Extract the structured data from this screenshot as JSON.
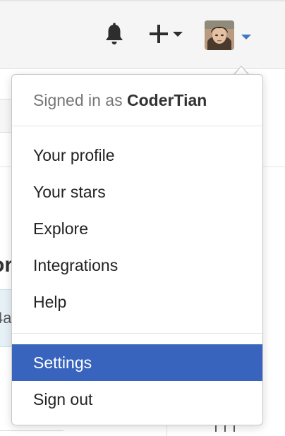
{
  "header": {
    "bell_icon": "bell-icon",
    "create_icon": "plus-icon",
    "create_caret_icon": "caret-down-icon",
    "avatar_icon": "user-avatar",
    "avatar_caret_icon": "caret-down-icon",
    "avatar_caret_color": "#4078c0"
  },
  "background": {
    "heading_fragment": "or",
    "box_fragment": "4a",
    "book_icon": "book-icon"
  },
  "dropdown": {
    "signed_in_prefix": "Signed in as",
    "username": "CoderTian",
    "primary_items": [
      {
        "label": "Your profile"
      },
      {
        "label": "Your stars"
      },
      {
        "label": "Explore"
      },
      {
        "label": "Integrations"
      },
      {
        "label": "Help"
      }
    ],
    "secondary_items": [
      {
        "label": "Settings",
        "highlighted": true
      },
      {
        "label": "Sign out",
        "highlighted": false
      }
    ],
    "highlight_color": "#3864be"
  }
}
